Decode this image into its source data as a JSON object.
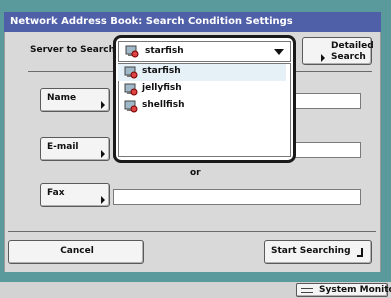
{
  "window": {
    "title": "Network Address Book: Search Condition Settings"
  },
  "server": {
    "label": "Server to Search",
    "selected": "starfish",
    "options": [
      "starfish",
      "jellyfish",
      "shellfish"
    ]
  },
  "detailed_search_label_line1": "Detailed",
  "detailed_search_label_line2": "Search",
  "fields": {
    "name_label": "Name",
    "email_label": "E-mail",
    "fax_label": "Fax",
    "or_text": "or"
  },
  "footer": {
    "cancel_label": "Cancel",
    "start_label": "Start Searching"
  },
  "status_bar": {
    "system_monitor_label": "System Monitor"
  }
}
